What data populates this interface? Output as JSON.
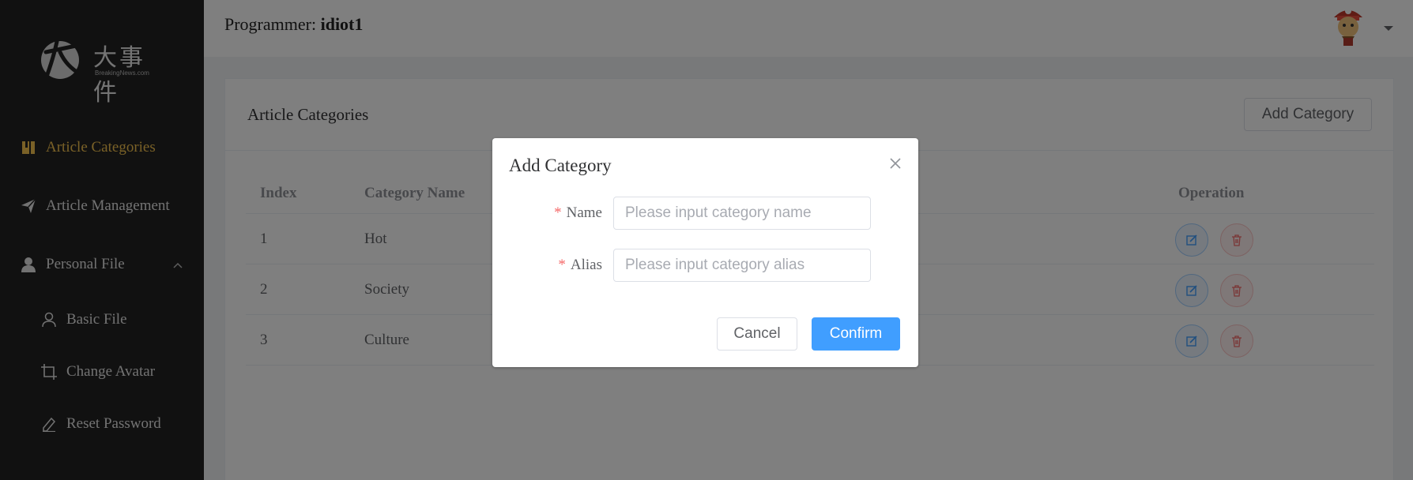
{
  "logo": {
    "text": "大事件",
    "sub": "BreakingNews.com"
  },
  "sidebar": {
    "items": [
      {
        "label": "Article Categories",
        "icon": "book-icon",
        "active": true
      },
      {
        "label": "Article Management",
        "icon": "paper-plane-icon"
      },
      {
        "label": "Personal File",
        "icon": "user-icon",
        "expanded": true
      },
      {
        "label": "Basic File",
        "icon": "user-outline-icon"
      },
      {
        "label": "Change Avatar",
        "icon": "crop-icon"
      },
      {
        "label": "Reset Password",
        "icon": "edit-pen-icon"
      }
    ]
  },
  "header": {
    "prefix": "Programmer: ",
    "username": "idiot1"
  },
  "card": {
    "title": "Article Categories",
    "add_label": "Add Category",
    "columns": [
      "Index",
      "Category Name",
      "Operation"
    ],
    "rows": [
      {
        "index": "1",
        "name": "Hot"
      },
      {
        "index": "2",
        "name": "Society"
      },
      {
        "index": "3",
        "name": "Culture"
      }
    ]
  },
  "dialog": {
    "title": "Add Category",
    "name_label": "Name",
    "name_placeholder": "Please input category name",
    "alias_label": "Alias",
    "alias_placeholder": "Please input category alias",
    "cancel_label": "Cancel",
    "confirm_label": "Confirm"
  },
  "colors": {
    "accent": "#f4c34f",
    "primary": "#409eff",
    "danger": "#f56c6c",
    "sidebar_bg": "#232323"
  }
}
